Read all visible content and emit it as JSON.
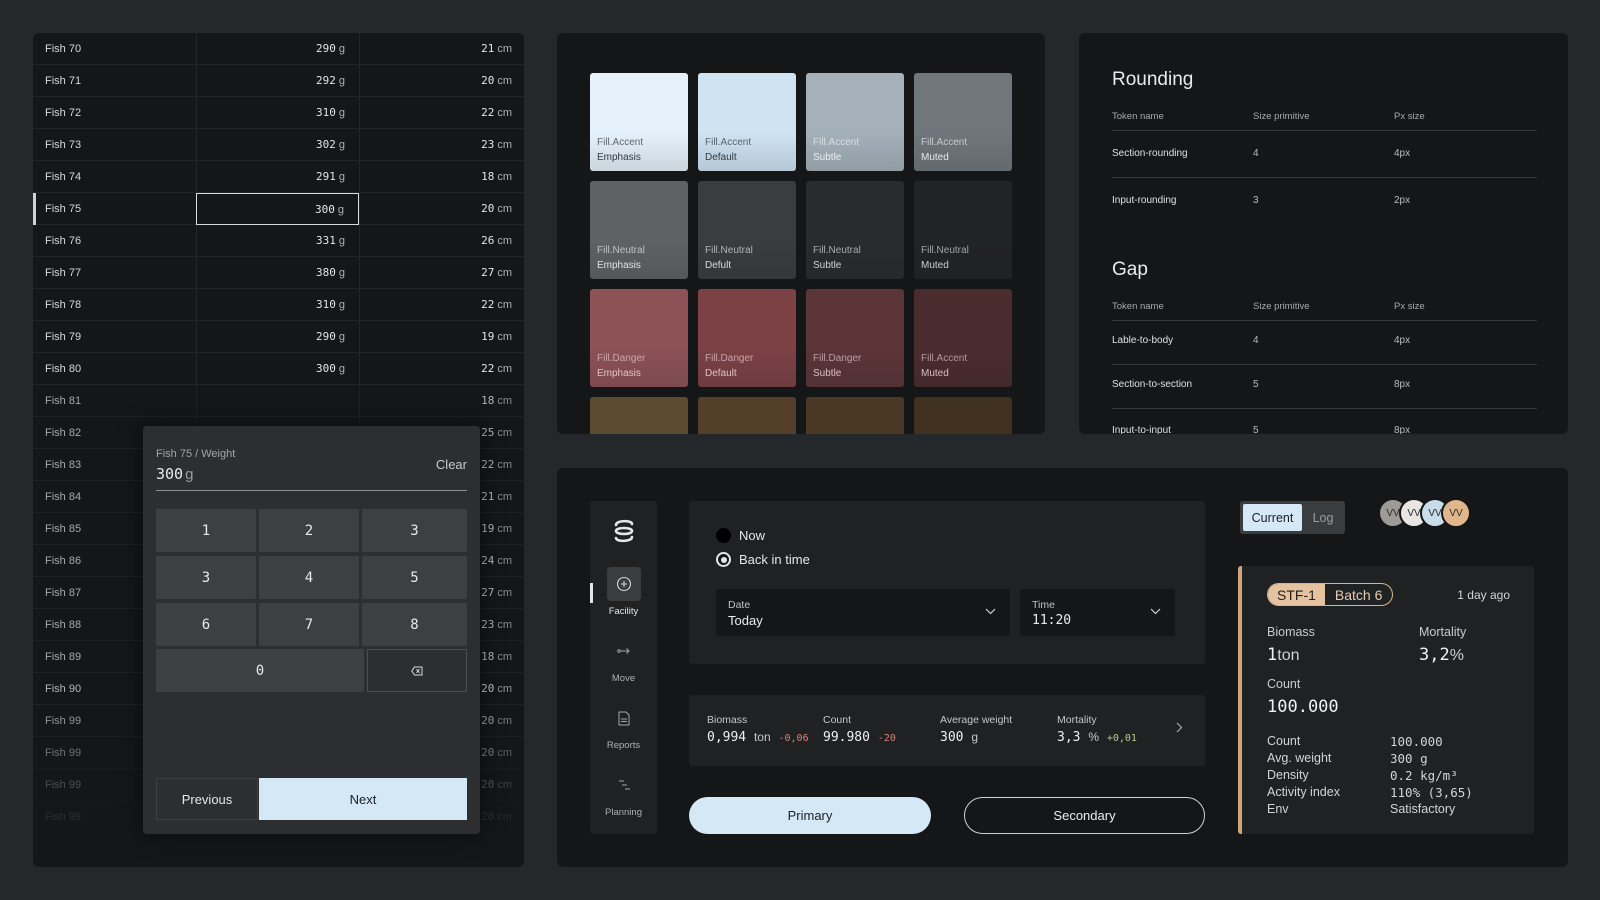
{
  "fish_table": {
    "rows": [
      {
        "name": "Fish 70",
        "weight": "290",
        "length": "21"
      },
      {
        "name": "Fish 71",
        "weight": "292",
        "length": "20"
      },
      {
        "name": "Fish 72",
        "weight": "310",
        "length": "22"
      },
      {
        "name": "Fish 73",
        "weight": "302",
        "length": "23"
      },
      {
        "name": "Fish 74",
        "weight": "291",
        "length": "18"
      },
      {
        "name": "Fish 75",
        "weight": "300",
        "length": "20"
      },
      {
        "name": "Fish 76",
        "weight": "331",
        "length": "26"
      },
      {
        "name": "Fish 77",
        "weight": "380",
        "length": "27"
      },
      {
        "name": "Fish 78",
        "weight": "310",
        "length": "22"
      },
      {
        "name": "Fish 79",
        "weight": "290",
        "length": "19"
      },
      {
        "name": "Fish 80",
        "weight": "300",
        "length": "22"
      },
      {
        "name": "Fish 81",
        "weight": "",
        "length": "18"
      },
      {
        "name": "Fish 82",
        "weight": "",
        "length": "25"
      },
      {
        "name": "Fish 83",
        "weight": "",
        "length": "22"
      },
      {
        "name": "Fish 84",
        "weight": "",
        "length": "21"
      },
      {
        "name": "Fish 85",
        "weight": "",
        "length": "19"
      },
      {
        "name": "Fish 86",
        "weight": "",
        "length": "24"
      },
      {
        "name": "Fish 87",
        "weight": "",
        "length": "27"
      },
      {
        "name": "Fish 88",
        "weight": "",
        "length": "23"
      },
      {
        "name": "Fish 89",
        "weight": "",
        "length": "18"
      },
      {
        "name": "Fish 90",
        "weight": "",
        "length": "20"
      },
      {
        "name": "Fish 99",
        "weight": "",
        "length": "20"
      },
      {
        "name": "Fish 99",
        "weight": "",
        "length": "20"
      },
      {
        "name": "Fish 99",
        "weight": "300",
        "length": "20"
      },
      {
        "name": "Fish 99",
        "weight": "300",
        "length": "20"
      }
    ],
    "weight_unit": "g",
    "length_unit": "cm",
    "active_row": "Fish 75"
  },
  "keypad": {
    "title": "Fish 75 / Weight",
    "value": "300",
    "unit": "g",
    "clear": "Clear",
    "keys": [
      "1",
      "2",
      "3",
      "3",
      "4",
      "5",
      "6",
      "7",
      "8",
      "0"
    ],
    "backspace_icon": "backspace-icon",
    "previous": "Previous",
    "next": "Next"
  },
  "swatches": [
    {
      "group": "Fill.Accent",
      "name": "Emphasis",
      "color": "#e6f2fb",
      "text": "#33393e"
    },
    {
      "group": "Fill.Accent",
      "name": "Default",
      "color": "#cfe3f3",
      "text": "#33393e"
    },
    {
      "group": "Fill.Accent",
      "name": "Subtle",
      "color": "#a4b1ba",
      "text": "#e9eef2"
    },
    {
      "group": "Fill.Accent",
      "name": "Muted",
      "color": "#6f777c",
      "text": "#e4e7e9"
    },
    {
      "group": "Fill.Neutral",
      "name": "Emphasis",
      "color": "#5f6163",
      "text": "#e1e2e3"
    },
    {
      "group": "Fill.Neutral",
      "name": "Defult",
      "color": "#3b3c3d",
      "text": "#dadbdc"
    },
    {
      "group": "Fill.Neutral",
      "name": "Subtle",
      "color": "#2a2b2c",
      "text": "#d3d4d5"
    },
    {
      "group": "Fill.Neutral",
      "name": "Muted",
      "color": "#222324",
      "text": "#cdcecf"
    },
    {
      "group": "Fill.Danger",
      "name": "Emphasis",
      "color": "#8d5256",
      "text": "#e0c2c4"
    },
    {
      "group": "Fill.Danger",
      "name": "Default",
      "color": "#7b4145",
      "text": "#e0c2c4"
    },
    {
      "group": "Fill.Danger",
      "name": "Subtle",
      "color": "#5c3538",
      "text": "#dcc0c2"
    },
    {
      "group": "Fill.Accent",
      "name": "Muted",
      "color": "#4a2c2f",
      "text": "#d7bdbf"
    },
    {
      "group": "",
      "name": "",
      "color": "#5c4a31",
      "text": "#000000"
    },
    {
      "group": "",
      "name": "",
      "color": "#54402a",
      "text": "#000000"
    },
    {
      "group": "",
      "name": "",
      "color": "#4a3824",
      "text": "#000000"
    },
    {
      "group": "",
      "name": "",
      "color": "#40301e",
      "text": "#000000"
    }
  ],
  "tokens": {
    "rounding": {
      "title": "Rounding",
      "headers": [
        "Token name",
        "Size primitive",
        "Px size"
      ],
      "rows": [
        [
          "Section-rounding",
          "4",
          "4px"
        ],
        [
          "Input-rounding",
          "3",
          "2px"
        ]
      ]
    },
    "gap": {
      "title": "Gap",
      "headers": [
        "Token name",
        "Size primitive",
        "Px size"
      ],
      "rows": [
        [
          "Lable-to-body",
          "4",
          "4px"
        ],
        [
          "Section-to-section",
          "5",
          "8px"
        ],
        [
          "Input-to-input",
          "5",
          "8px"
        ]
      ]
    }
  },
  "app": {
    "sidebar": [
      {
        "label": "Facility",
        "icon": "plus-circle-icon"
      },
      {
        "label": "Move",
        "icon": "move-arrow-icon"
      },
      {
        "label": "Reports",
        "icon": "document-icon"
      },
      {
        "label": "Planning",
        "icon": "planning-icon"
      }
    ],
    "time": {
      "now": "Now",
      "back": "Back in time",
      "date_label": "Date",
      "date_value": "Today",
      "time_label": "Time",
      "time_value": "11:20"
    },
    "stats": {
      "biomass_label": "Biomass",
      "biomass_value": "0,994",
      "biomass_unit": "ton",
      "biomass_delta": "-0,06",
      "count_label": "Count",
      "count_value": "99.980",
      "count_delta": "-20",
      "avg_label": "Average weight",
      "avg_value": "300",
      "avg_unit": "g",
      "mort_label": "Mortality",
      "mort_value": "3,3",
      "mort_unit": "%",
      "mort_delta": "+0,01"
    },
    "primary": "Primary",
    "secondary": "Secondary",
    "toggle": {
      "current": "Current",
      "log": "Log"
    },
    "avatars": [
      "VV",
      "VV",
      "VV",
      "VV"
    ],
    "batch": {
      "tag": "STF-1",
      "batch": "Batch 6",
      "time": "1 day ago",
      "biomass_label": "Biomass",
      "biomass_value": "1",
      "biomass_unit": "ton",
      "mortality_label": "Mortality",
      "mortality_value": "3,2",
      "mortality_unit": "%",
      "count_label": "Count",
      "count_value": "100.000",
      "details": [
        [
          "Count",
          "100.000"
        ],
        [
          "Avg. weight",
          "300 g"
        ],
        [
          "Density",
          "0.2 kg/m³"
        ],
        [
          "Activity index",
          "110% (3,65)"
        ],
        [
          "Env",
          "Satisfactory"
        ]
      ]
    }
  }
}
